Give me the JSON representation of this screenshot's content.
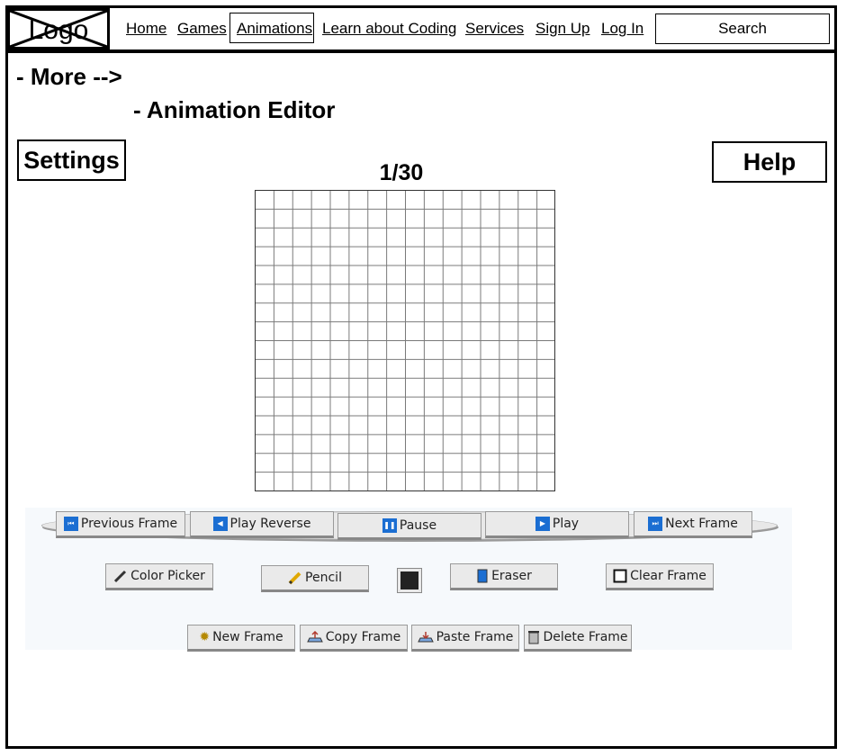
{
  "nav": {
    "logo": "Logo",
    "links": [
      "Home",
      "Games",
      "Animations",
      "Learn about Coding",
      "Services",
      "Sign Up",
      "Log In"
    ],
    "search": "Search"
  },
  "page": {
    "more": "- More -->",
    "breadcrumb": "- Animation Editor",
    "settings": "Settings",
    "help": "Help",
    "frame_counter": "1/30"
  },
  "editor": {
    "grid": {
      "columns": 16,
      "rows": 16
    },
    "current_color": "#222222"
  },
  "playback": [
    "Previous Frame",
    "Play Reverse",
    "Pause",
    "Play",
    "Next Frame"
  ],
  "tools": [
    "Color Picker",
    "Pencil",
    "Eraser",
    "Clear Frame"
  ],
  "frames": [
    "New Frame",
    "Copy Frame",
    "Paste Frame",
    "Delete Frame"
  ]
}
